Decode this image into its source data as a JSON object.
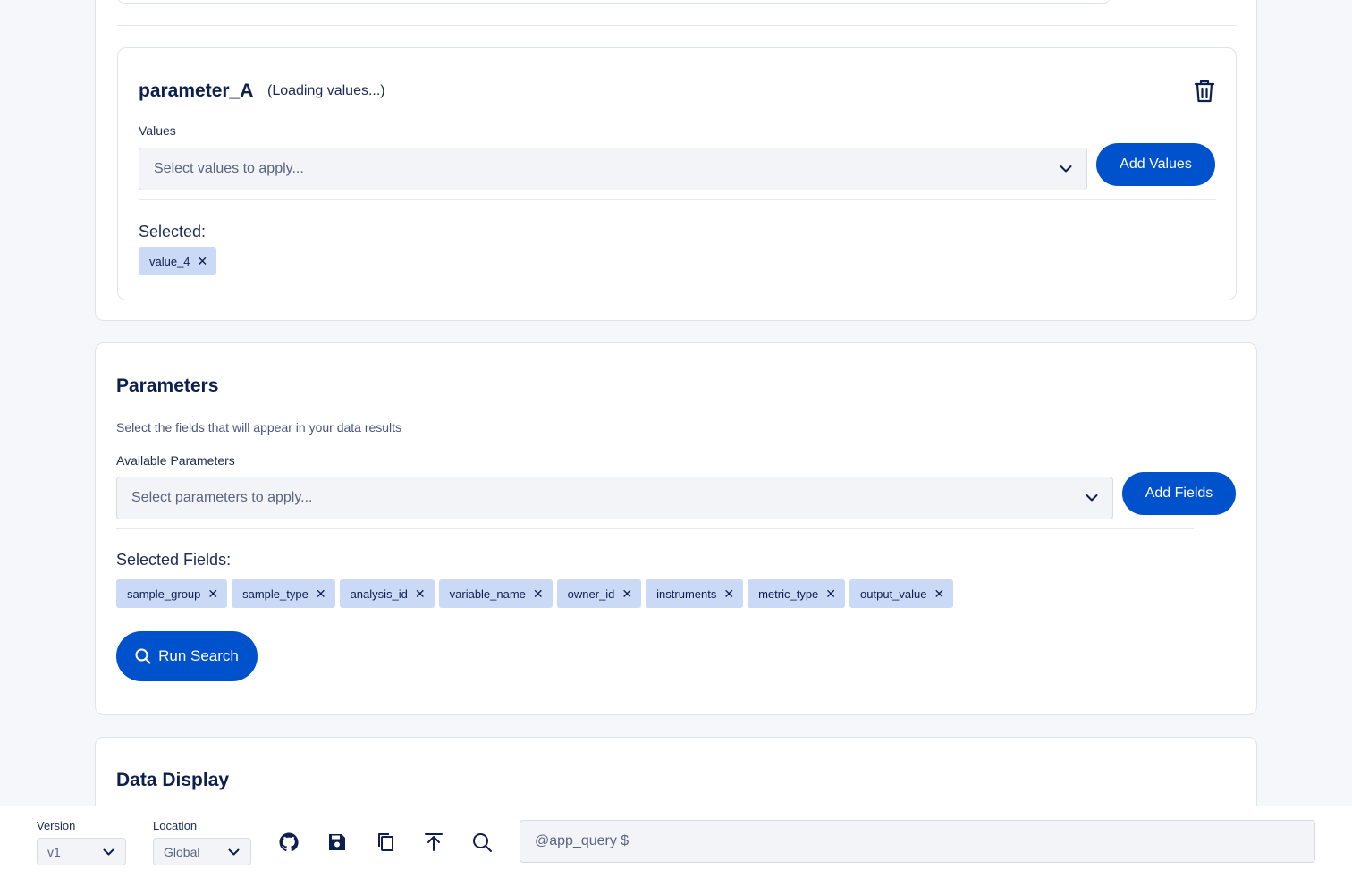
{
  "parameter_card": {
    "name": "parameter_A",
    "status": "(Loading values...)",
    "values_label": "Values",
    "values_placeholder": "Select values to apply...",
    "add_values_label": "Add Values",
    "selected_label": "Selected:",
    "selected_chips": [
      "value_4"
    ]
  },
  "parameters_section": {
    "title": "Parameters",
    "description": "Select the fields that will appear in your data results",
    "available_label": "Available Parameters",
    "placeholder": "Select parameters to apply...",
    "add_fields_label": "Add Fields",
    "selected_label": "Selected Fields:",
    "selected_fields": [
      "sample_group",
      "sample_type",
      "analysis_id",
      "variable_name",
      "owner_id",
      "instruments",
      "metric_type",
      "output_value"
    ],
    "run_search_label": "Run Search"
  },
  "data_display": {
    "title": "Data Display"
  },
  "bottom_bar": {
    "version_label": "Version",
    "version_value": "v1",
    "location_label": "Location",
    "location_value": "Global",
    "icons": [
      "github-icon",
      "save-icon",
      "copy-icon",
      "upload-icon",
      "search-icon"
    ],
    "query_placeholder": "@app_query $"
  },
  "colors": {
    "primary": "#0052cc",
    "navy": "#0d1f4f",
    "chip_bg": "#cad9f5"
  }
}
